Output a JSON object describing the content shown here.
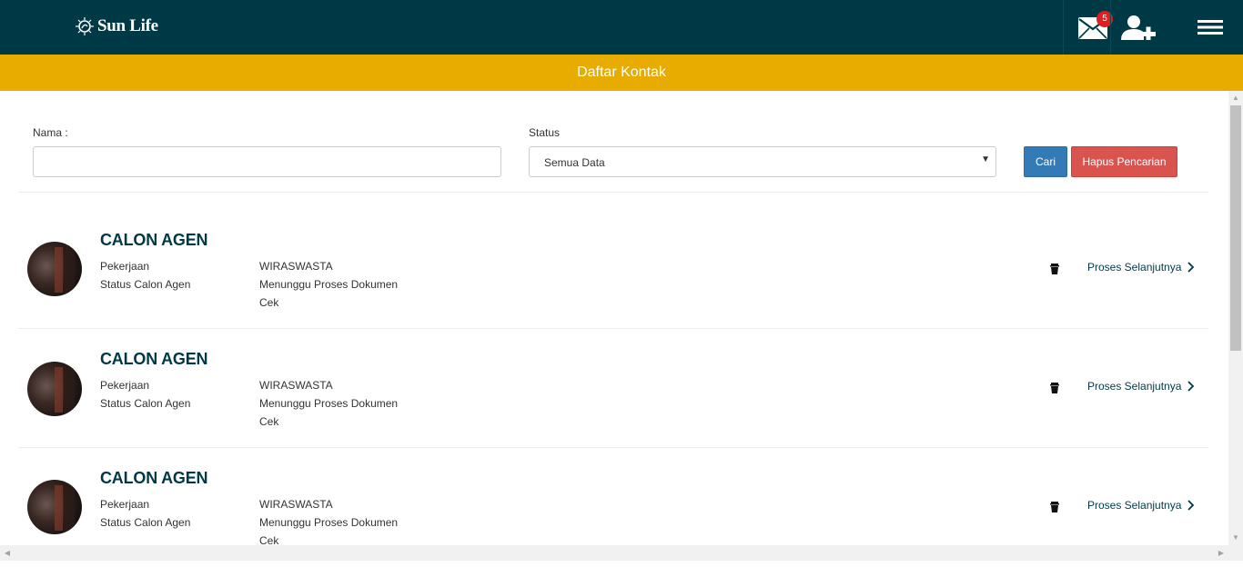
{
  "header": {
    "brand": "Sun Life",
    "mail_badge": "5",
    "colors": {
      "topbar": "#003946",
      "titlebar": "#e8ab00",
      "badge": "#e01e1e"
    }
  },
  "page": {
    "title": "Daftar Kontak"
  },
  "filter": {
    "name_label": "Nama :",
    "name_value": "",
    "name_placeholder": "",
    "status_label": "Status",
    "status_selected": "Semua Data",
    "search_button": "Cari",
    "clear_button": "Hapus Pencarian"
  },
  "contacts": [
    {
      "name": "CALON AGEN",
      "job_label": "Pekerjaan",
      "job_value": "WIRASWASTA",
      "status_label": "Status Calon Agen",
      "status_value_line1": "Menunggu Proses Dokumen",
      "status_value_line2": "Cek",
      "next_label": "Proses Selanjutnya"
    },
    {
      "name": "CALON AGEN",
      "job_label": "Pekerjaan",
      "job_value": "WIRASWASTA",
      "status_label": "Status Calon Agen",
      "status_value_line1": "Menunggu Proses Dokumen",
      "status_value_line2": "Cek",
      "next_label": "Proses Selanjutnya"
    },
    {
      "name": "CALON AGEN",
      "job_label": "Pekerjaan",
      "job_value": "WIRASWASTA",
      "status_label": "Status Calon Agen",
      "status_value_line1": "Menunggu Proses Dokumen",
      "status_value_line2": "Cek",
      "next_label": "Proses Selanjutnya"
    }
  ]
}
